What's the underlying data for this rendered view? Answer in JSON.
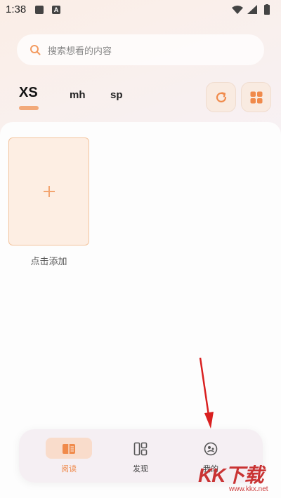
{
  "status_bar": {
    "time": "1:38",
    "notif_letter": "A"
  },
  "search": {
    "placeholder": "搜索想看的内容"
  },
  "tabs": [
    {
      "label": "XS",
      "active": true
    },
    {
      "label": "mh",
      "active": false
    },
    {
      "label": "sp",
      "active": false
    }
  ],
  "toolbar": {
    "refresh_icon": "refresh-icon",
    "grid_icon": "grid-icon"
  },
  "shelf": {
    "add_label": "点击添加"
  },
  "bottom_nav": {
    "items": [
      {
        "label": "阅读",
        "icon": "book-icon",
        "active": true
      },
      {
        "label": "发现",
        "icon": "discover-icon",
        "active": false
      },
      {
        "label": "我的",
        "icon": "profile-icon",
        "active": false
      }
    ]
  },
  "watermark": {
    "main": "KK下载",
    "sub": "www.kkx.net"
  },
  "colors": {
    "accent": "#f08a4b",
    "accent_light": "#f9dccb",
    "arrow": "#d92020"
  }
}
